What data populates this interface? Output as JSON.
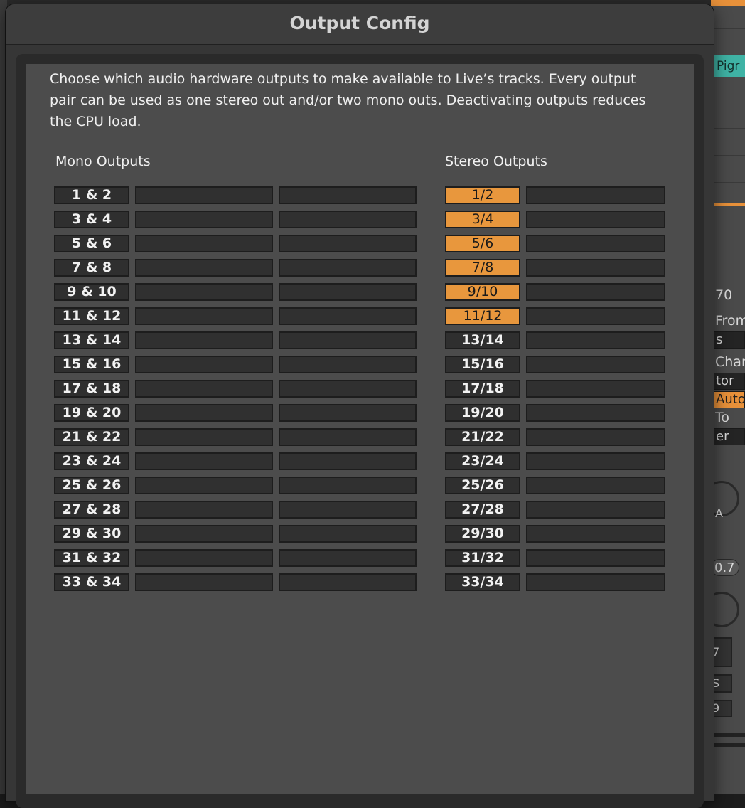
{
  "dialog": {
    "title": "Output Config",
    "description": "Choose which audio hardware outputs to make available to Live’s tracks. Every output pair can be used as one stereo out and/or two mono outs.  Deactivating outputs reduces the CPU load."
  },
  "mono": {
    "heading": "Mono Outputs",
    "pairs": [
      "1 & 2",
      "3 & 4",
      "5 & 6",
      "7 & 8",
      "9 & 10",
      "11 & 12",
      "13 & 14",
      "15 & 16",
      "17 & 18",
      "19 & 20",
      "21 & 22",
      "23 & 24",
      "25 & 26",
      "27 & 28",
      "29 & 30",
      "31 & 32",
      "33 & 34"
    ]
  },
  "stereo": {
    "heading": "Stereo Outputs",
    "pairs": [
      {
        "label": "1/2",
        "active": true
      },
      {
        "label": "3/4",
        "active": true
      },
      {
        "label": "5/6",
        "active": true
      },
      {
        "label": "7/8",
        "active": true
      },
      {
        "label": "9/10",
        "active": true
      },
      {
        "label": "11/12",
        "active": true
      },
      {
        "label": "13/14",
        "active": false
      },
      {
        "label": "15/16",
        "active": false
      },
      {
        "label": "17/18",
        "active": false
      },
      {
        "label": "19/20",
        "active": false
      },
      {
        "label": "21/22",
        "active": false
      },
      {
        "label": "23/24",
        "active": false
      },
      {
        "label": "25/26",
        "active": false
      },
      {
        "label": "27/28",
        "active": false
      },
      {
        "label": "29/30",
        "active": false
      },
      {
        "label": "31/32",
        "active": false
      },
      {
        "label": "33/34",
        "active": false
      }
    ]
  },
  "colors": {
    "active": "#e8973d",
    "cell": "#2f2f2f",
    "panel": "#4c4c4c"
  },
  "background_app": {
    "teal_tag": "Pigr",
    "texts": [
      "70",
      "From",
      "s",
      "Char",
      "tor",
      "Auto",
      "To",
      "er",
      "A",
      "0.7",
      "7",
      "S",
      "9"
    ]
  }
}
